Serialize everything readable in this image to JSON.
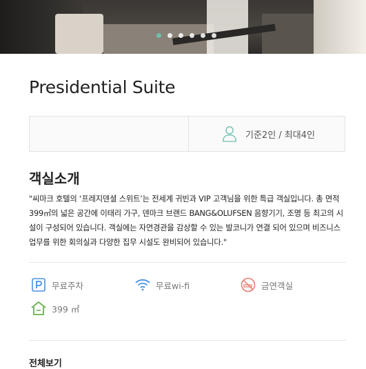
{
  "hero": {
    "slide_count": 6,
    "active_index": 0
  },
  "room": {
    "title": "Presidential Suite",
    "capacity": "기준2인 / 최대4인"
  },
  "intro": {
    "heading": "객실소개",
    "description": "\"씨마크 호텔의 ‘프레지덴셜 스위트’는 전세계 귀빈과 VIP 고객님을 위한 특급 객실입니다. 총 면적 399㎡의 넓은 공간에 이태리 가구, 덴마크 브랜드 BANG&OLUFSEN 음향기기, 조명 등 최고의 시설이 구성되어 있습니다. 객실에는 자연경관을 감상할 수 있는 발코니가 연결 되어 있으며 비즈니스 업무를 위한 회의실과 다양한 집무 시설도 완비되어 있습니다.\""
  },
  "amenities": {
    "parking": {
      "label": "무료주차",
      "icon": "parking-icon",
      "color": "#4a90e2"
    },
    "wifi": {
      "label": "무료wi-fi",
      "icon": "wifi-icon",
      "color": "#4a90e2"
    },
    "nonsmoking": {
      "label": "금연객실",
      "icon": "no-smoking-icon",
      "color": "#e8756a"
    },
    "area": {
      "label": "399 ㎡",
      "icon": "house-icon",
      "color": "#6ab04c"
    }
  },
  "footer": {
    "view_all": "전체보기"
  },
  "colors": {
    "accent": "#6dbfae"
  }
}
